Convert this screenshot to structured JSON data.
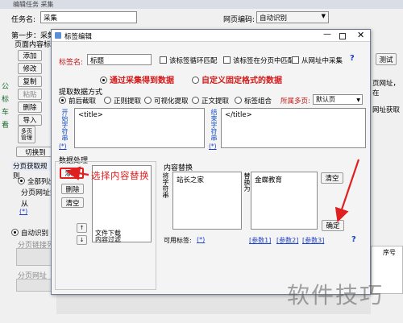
{
  "back_window": {
    "title": "编辑任务 采集",
    "task_name_label": "任务名:",
    "task_name_value": "采集",
    "encoding_label": "网页编码:",
    "encoding_value": "自动识别",
    "step1": "第一步：采集",
    "content_tag": "页面内容标签",
    "left_buttons": [
      "添加",
      "修改",
      "复制",
      "粘贴",
      "删除",
      "导入"
    ],
    "multi_page_label": "多页管理",
    "switch_button": "切换到",
    "pagination_label": "分页获取规则",
    "radio_list_all": "全部列出",
    "paging_url_rule": "分页网址规则",
    "from_label": "从",
    "auto_recog": "自动识别",
    "paging_list": "分页链接列",
    "paging_url": "分页网址",
    "side_letters": [
      "公",
      "标",
      "车",
      "看"
    ],
    "right_test_button": "测试",
    "right_text1": "页网址，在",
    "right_text2": "网址获取",
    "right_col_header": "序号"
  },
  "dialog": {
    "title": "标签编辑",
    "tag_name_label": "标签名:",
    "tag_name_value": "标题",
    "opt_loop_match": "该标签循环匹配",
    "opt_pagination": "该标签在分页中匹配",
    "opt_collect_url": "从网址中采集",
    "radio_collect_data": "通过采集得到数据",
    "radio_custom_data": "自定义固定格式的数据",
    "extract_section": "提取数据方式",
    "extract_opts": [
      "前后截取",
      "正则提取",
      "可视化提取",
      "正文提取",
      "标签组合"
    ],
    "page_label": "所属多页:",
    "page_value": "默认页",
    "start_label": "开始字符串",
    "start_value": "<title>",
    "end_label": "结束字符串",
    "end_value": "</title>",
    "process_section": "数据处理",
    "btn_add": "添加",
    "btn_delete": "删除",
    "btn_clear": "清空",
    "process_items": [
      "文件下载",
      "内容过滤"
    ],
    "replace_section": "内容替换",
    "replace_from_label": "将字符串",
    "replace_from_value": "站长之家",
    "replace_to_label": "替换为",
    "replace_to_value": "金蝶教育",
    "btn_replace_clear": "清空",
    "btn_confirm": "确定",
    "available_tags_label": "可用标签:",
    "available_tags": [
      "(*)",
      "[参数1]",
      "[参数2]",
      "[参数3]"
    ],
    "star": "(*)",
    "help": "?"
  },
  "annotation": {
    "text": "选择内容替换",
    "color": "#e02020"
  },
  "watermark": "软件技巧",
  "colors": {
    "accent_red": "#d21a1a",
    "link_blue": "#1a3fc9",
    "arrow_red": "#e02020"
  }
}
